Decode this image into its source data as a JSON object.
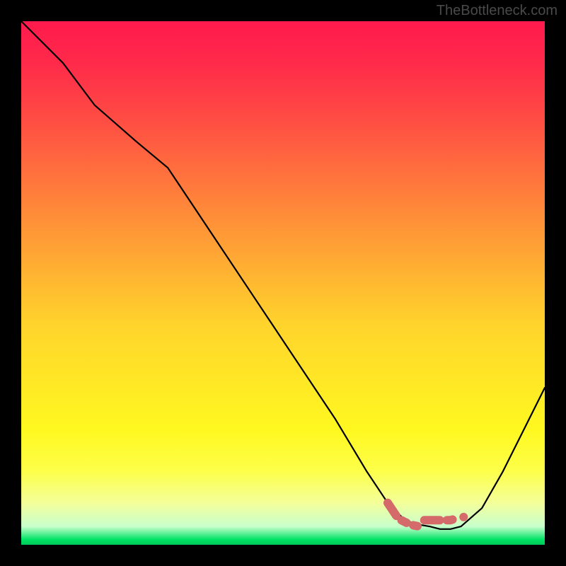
{
  "watermark": "TheBottleneck.com",
  "chart_data": {
    "type": "line",
    "title": "",
    "xlabel": "",
    "ylabel": "",
    "xlim": [
      0,
      100
    ],
    "ylim": [
      0,
      100
    ],
    "series": [
      {
        "name": "main-curve",
        "x": [
          0,
          8,
          14,
          22,
          28,
          36,
          44,
          52,
          60,
          66,
          70,
          73,
          75,
          78,
          80,
          82,
          84,
          88,
          92,
          96,
          100
        ],
        "y": [
          100,
          92,
          84,
          77,
          72,
          60,
          48,
          36,
          24,
          14,
          8,
          5,
          4,
          3.5,
          3,
          3,
          3.5,
          7,
          14,
          22,
          30
        ]
      },
      {
        "name": "dashed-marker",
        "x": [
          70,
          72,
          73,
          74,
          75,
          76,
          77,
          78,
          79,
          82,
          83
        ],
        "y": [
          8,
          5,
          4.5,
          4,
          3.7,
          3.5,
          4.7,
          4.7,
          4.7,
          4.7,
          5
        ]
      }
    ],
    "gradient_stops": [
      {
        "offset": 0,
        "color": "#ff1a4d"
      },
      {
        "offset": 0.18,
        "color": "#ff4a44"
      },
      {
        "offset": 0.38,
        "color": "#ff9038"
      },
      {
        "offset": 0.58,
        "color": "#ffd42c"
      },
      {
        "offset": 0.78,
        "color": "#fff820"
      },
      {
        "offset": 0.92,
        "color": "#f4ff9a"
      },
      {
        "offset": 0.99,
        "color": "#00e266"
      },
      {
        "offset": 1.0,
        "color": "#00c858"
      }
    ]
  }
}
